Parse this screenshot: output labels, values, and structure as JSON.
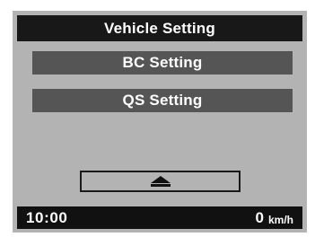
{
  "header": {
    "title": "Vehicle Setting"
  },
  "menu": {
    "items": [
      {
        "label": "BC Setting"
      },
      {
        "label": "QS Setting"
      }
    ]
  },
  "controls": {
    "up_icon": "up-triangle-icon"
  },
  "status": {
    "time": "10:00",
    "speed": "0",
    "speed_unit": "km/h"
  },
  "colors": {
    "screen_background": "#b3b3b3",
    "header_background": "#181818",
    "menu_item_background": "#555555",
    "status_bar_background": "#111111",
    "text": "#ffffff"
  }
}
